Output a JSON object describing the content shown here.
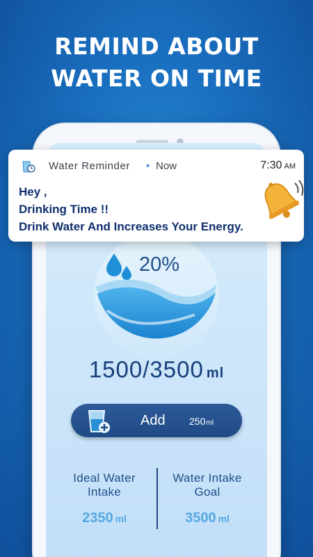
{
  "headline": {
    "line1": "REMIND ABOUT",
    "line2": "WATER ON TIME"
  },
  "notification": {
    "app_name": "Water Reminder",
    "separator": "•",
    "when": "Now",
    "time": "7:30",
    "meridiem": "AM",
    "line1": "Hey ,",
    "line2": "Drinking Time !!",
    "line3": "Drink Water And Increases Your Energy."
  },
  "progress": {
    "percent_label": "20%",
    "fraction": 0.2
  },
  "intake": {
    "current": "1500/3500",
    "unit": "ml"
  },
  "add_button": {
    "label": "Add",
    "amount": "250",
    "unit": "ml"
  },
  "stats": {
    "ideal": {
      "label_line1": "Ideal Water",
      "label_line2": "Intake",
      "value": "2350",
      "unit": "ml"
    },
    "goal": {
      "label_line1": "Water Intake",
      "label_line2": "Goal",
      "value": "3500",
      "unit": "ml"
    }
  },
  "colors": {
    "background": "#1a6fc0",
    "accent_dark": "#1f4a85",
    "accent_light": "#56a9e0",
    "notification_text": "#0f2f6e",
    "bell": "#f4b43a"
  }
}
